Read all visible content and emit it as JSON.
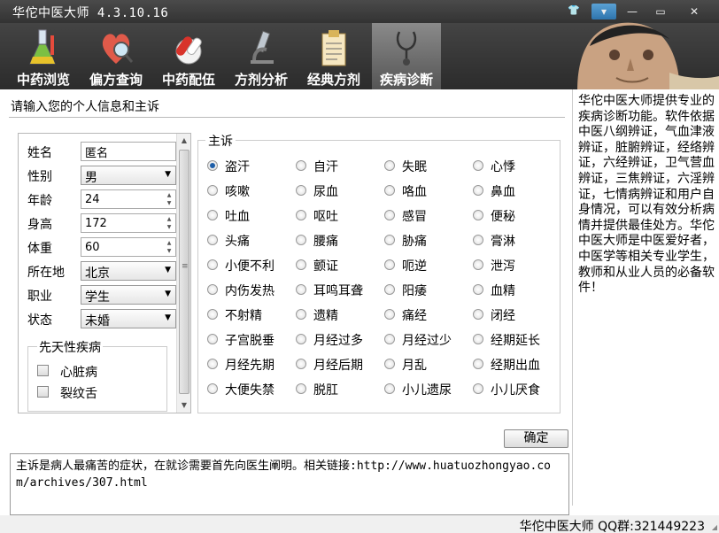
{
  "app": {
    "title": "华佗中医大师 4.3.10.16"
  },
  "toolbar": {
    "tabs": [
      {
        "label": "中药浏览",
        "icon": "flask-icon"
      },
      {
        "label": "偏方查询",
        "icon": "heart-search-icon"
      },
      {
        "label": "中药配伍",
        "icon": "pills-icon"
      },
      {
        "label": "方剂分析",
        "icon": "microscope-icon"
      },
      {
        "label": "经典方剂",
        "icon": "clipboard-icon"
      },
      {
        "label": "疾病诊断",
        "icon": "stethoscope-icon"
      }
    ],
    "active_tab": "疾病诊断"
  },
  "prompt": "请输入您的个人信息和主诉",
  "form": {
    "name_label": "姓名",
    "name_value": "匿名",
    "gender_label": "性别",
    "gender_value": "男",
    "age_label": "年龄",
    "age_value": "24",
    "height_label": "身高",
    "height_value": "172",
    "weight_label": "体重",
    "weight_value": "60",
    "location_label": "所在地",
    "location_value": "北京",
    "job_label": "职业",
    "job_value": "学生",
    "status_label": "状态",
    "status_value": "未婚",
    "congenital_title": "先天性疾病",
    "congenital": [
      "心脏病",
      "裂纹舌"
    ]
  },
  "complaint": {
    "title": "主诉",
    "selected": "盗汗",
    "options": [
      "盗汗",
      "自汗",
      "失眠",
      "心悸",
      "咳嗽",
      "尿血",
      "咯血",
      "鼻血",
      "吐血",
      "呕吐",
      "感冒",
      "便秘",
      "头痛",
      "腰痛",
      "胁痛",
      "膏淋",
      "小便不利",
      "颤证",
      "呃逆",
      "泄泻",
      "内伤发热",
      "耳鸣耳聋",
      "阳痿",
      "血精",
      "不射精",
      "遗精",
      "痛经",
      "闭经",
      "子宫脱垂",
      "月经过多",
      "月经过少",
      "经期延长",
      "月经先期",
      "月经后期",
      "月乱",
      "经期出血",
      "大便失禁",
      "脱肛",
      "小儿遗尿",
      "小儿厌食"
    ]
  },
  "ok_button": "确定",
  "info_text": "华佗中医大师提供专业的疾病诊断功能。软件依据中医八纲辨证，气血津液辨证，脏腑辨证，经络辨证，六经辨证，卫气营血辨证，三焦辨证，六淫辨证，七情病辨证和用户自身情况，可以有效分析病情并提供最佳处方。华佗中医大师是中医爱好者，中医学等相关专业学生，教师和从业人员的必备软件！",
  "notes": "主诉是病人最痛苦的症状，在就诊需要首先向医生阐明。相关链接:http://www.huatuozhongyao.com/archives/307.html",
  "status_bar": "华佗中医大师 QQ群:321449223",
  "colors": {
    "toolbar_bg": "#333333",
    "active_tab": "#6e6e6e",
    "radio_dot": "#1f5fa8"
  }
}
